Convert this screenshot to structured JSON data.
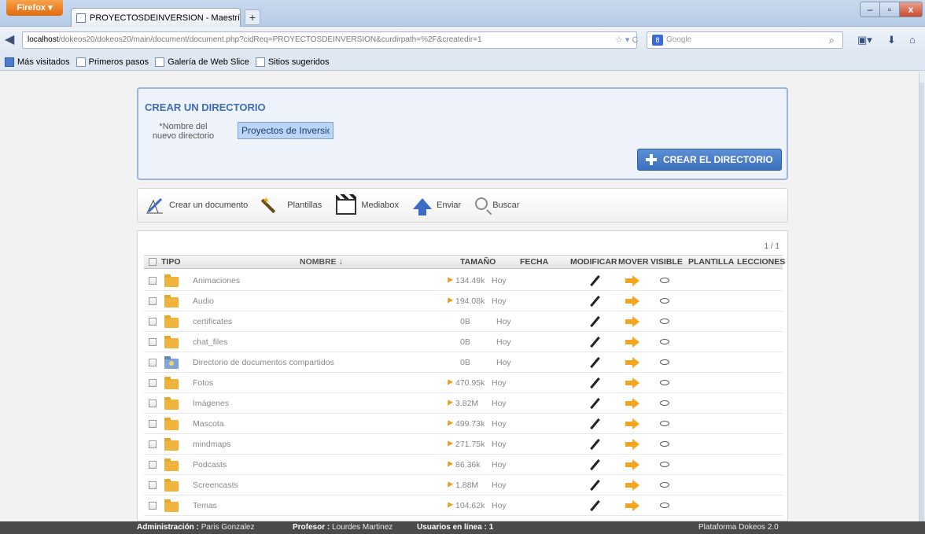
{
  "browser": {
    "menu_button": "Firefox",
    "tab_title": "PROYECTOSDEINVERSION - Maestría en ...",
    "new_tab": "+",
    "url_host": "localhost",
    "url_rest": "/dokeos20/dokeos20/main/document/document.php?cidReq=PROYECTOSDEINVERSION&curdirpath=%2F&createdir=1",
    "search_placeholder": "Google",
    "window_min": "–",
    "window_max": "▫",
    "window_close": "x",
    "bookmarks": [
      "Más visitados",
      "Primeros pasos",
      "Galería de Web Slice",
      "Sitios sugeridos"
    ]
  },
  "create_dir": {
    "title": "CREAR UN DIRECTORIO",
    "field_label": "*Nombre del nuevo directorio",
    "field_value": "Proyectos de Inversion",
    "button_label": "CREAR EL DIRECTORIO"
  },
  "toolbar": {
    "create_doc": "Crear un documento",
    "templates": "Plantillas",
    "mediabox": "Mediabox",
    "upload": "Enviar",
    "search": "Buscar"
  },
  "table": {
    "pager": "1 / 1",
    "headers": {
      "type": "TIPO",
      "name": "NOMBRE ↓",
      "size": "TAMAÑO",
      "date": "FECHA",
      "edit": "MODIFICAR",
      "move": "MOVER",
      "visible": "VISIBLE",
      "template": "PLANTILLA",
      "lessons": "LECCIONES"
    },
    "rows": [
      {
        "name": "Animaciones",
        "size": "134.49k",
        "date": "Hoy",
        "shared": false,
        "has_arrow": true
      },
      {
        "name": "Audio",
        "size": "194.08k",
        "date": "Hoy",
        "shared": false,
        "has_arrow": true
      },
      {
        "name": "certificates",
        "size": "0B",
        "date": "Hoy",
        "shared": false,
        "has_arrow": false
      },
      {
        "name": "chat_files",
        "size": "0B",
        "date": "Hoy",
        "shared": false,
        "has_arrow": false
      },
      {
        "name": "Directorio de documentos compartidos",
        "size": "0B",
        "date": "Hoy",
        "shared": true,
        "has_arrow": false
      },
      {
        "name": "Fotos",
        "size": "470.95k",
        "date": "Hoy",
        "shared": false,
        "has_arrow": true
      },
      {
        "name": "Imágenes",
        "size": "3.82M",
        "date": "Hoy",
        "shared": false,
        "has_arrow": true
      },
      {
        "name": "Mascota",
        "size": "499.73k",
        "date": "Hoy",
        "shared": false,
        "has_arrow": true
      },
      {
        "name": "mindmaps",
        "size": "271.75k",
        "date": "Hoy",
        "shared": false,
        "has_arrow": true
      },
      {
        "name": "Podcasts",
        "size": "86.36k",
        "date": "Hoy",
        "shared": false,
        "has_arrow": true
      },
      {
        "name": "Screencasts",
        "size": "1.88M",
        "date": "Hoy",
        "shared": false,
        "has_arrow": true
      },
      {
        "name": "Temas",
        "size": "104.62k",
        "date": "Hoy",
        "shared": false,
        "has_arrow": true
      }
    ]
  },
  "status": {
    "admin_label": "Administración :",
    "admin_name": "Paris Gonzalez",
    "teacher_label": "Profesor :",
    "teacher_name": "Lourdes Martinez",
    "online_label": "Usuarios en línea :",
    "online_count": "1",
    "platform": "Plataforma Dokeos 2.0"
  },
  "colors": {
    "accent": "#3f6cb7",
    "button": "#3d70bd",
    "folder": "#f0b43c",
    "move_arrow": "#f3a51f"
  },
  "icons": [
    "firefox-icon",
    "back-arrow-icon",
    "search-icon",
    "plus-icon",
    "pencil-icon",
    "magic-wand-icon",
    "clapper-icon",
    "upload-arrow-icon",
    "magnifier-icon",
    "folder-icon",
    "shared-folder-icon",
    "size-arrow-icon",
    "edit-pencil-icon",
    "move-arrow-icon",
    "visibility-eye-icon"
  ]
}
